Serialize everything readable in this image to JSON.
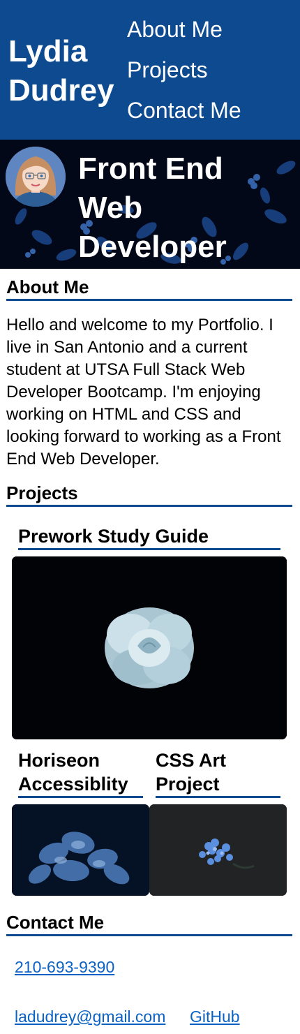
{
  "header": {
    "title_line1": "Lydia",
    "title_line2": "Dudrey",
    "nav": [
      "About Me",
      "Projects",
      "Contact Me"
    ]
  },
  "hero": {
    "title_lines": [
      "Front End",
      "Web",
      "Developer"
    ],
    "avatar_icon": "cartoon-avatar-icon"
  },
  "about": {
    "heading": "About Me",
    "text": "Hello and welcome to my Portfolio. I live in San Antonio and a current student at UTSA Full Stack Web Developer Bootcamp. I'm enjoying working on HTML and CSS and looking forward to working as a Front End Web Developer."
  },
  "projects": {
    "heading": "Projects",
    "items": [
      {
        "title": "Prework Study Guide"
      },
      {
        "title_lines": [
          "Horiseon",
          "Accessiblity"
        ]
      },
      {
        "title_lines": [
          "CSS Art",
          "Project"
        ]
      }
    ]
  },
  "contact": {
    "heading": "Contact Me",
    "phone": "210-693-9390",
    "email": "ladudrey@gmail.com",
    "github": "GitHub"
  },
  "colors": {
    "accent": "#0d4a8f",
    "link": "#0b62c4"
  }
}
